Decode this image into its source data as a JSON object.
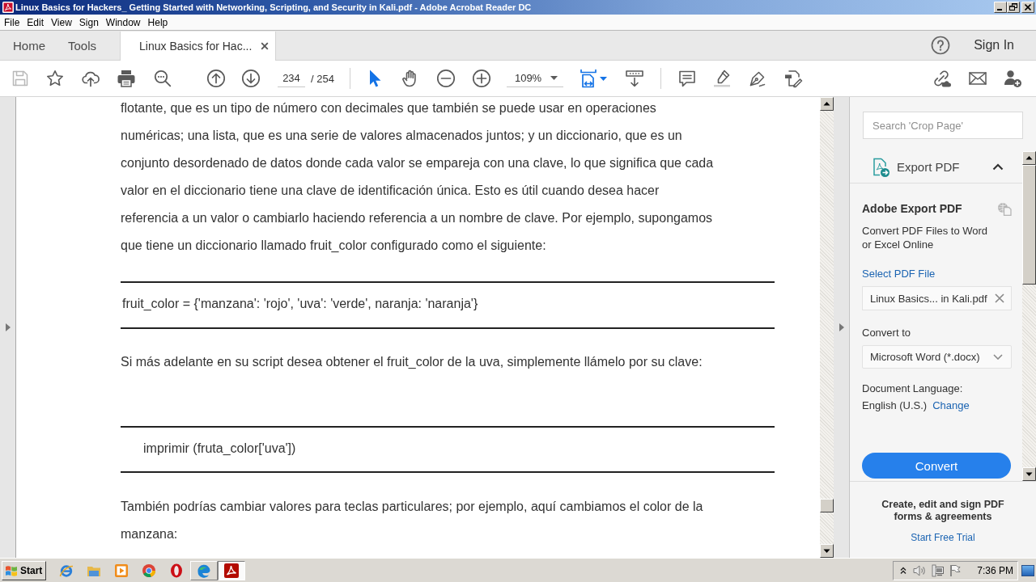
{
  "window": {
    "title": "Linux Basics for Hackers_ Getting Started with Networking, Scripting, and Security in Kali.pdf - Adobe Acrobat Reader DC"
  },
  "menu": [
    "File",
    "Edit",
    "View",
    "Sign",
    "Window",
    "Help"
  ],
  "tabs": [
    {
      "kind": "nav",
      "label": "Home",
      "selected": false
    },
    {
      "kind": "nav",
      "label": "Tools",
      "selected": false
    },
    {
      "kind": "document",
      "label": "Linux Basics for Hac...",
      "selected": true
    }
  ],
  "account": {
    "sign_in": "Sign In"
  },
  "toolbar": {
    "save": {
      "disabled": true
    },
    "page_current": "234",
    "page_total": "/ 254",
    "pointer_tools": [
      {
        "kind": "select",
        "selected": true
      },
      {
        "kind": "hand",
        "selected": false
      }
    ],
    "zoom": "109%"
  },
  "document": {
    "blocks": [
      {
        "kind": "paragraph",
        "text": "flotante, que es un tipo de número con decimales que también se puede usar en operaciones\nnuméricas; una lista, que es una serie de valores almacenados juntos; y un diccionario, que es un\nconjunto desordenado de datos donde cada valor se empareja con una clave, lo que significa que cada\nvalor en el diccionario tiene una clave de identificación única. Esto es útil cuando desea hacer\nreferencia a un valor o cambiarlo haciendo referencia a un nombre de clave. Por ejemplo, supongamos\nque tiene un diccionario llamado fruit_color configurado como el siguiente:"
      },
      {
        "kind": "code",
        "indented": false,
        "text": "fruit_color = {'manzana': 'rojo', 'uva': 'verde', naranja: 'naranja'}"
      },
      {
        "kind": "paragraph",
        "text": "Si más adelante en su script desea obtener el fruit_color de la uva, simplemente llámelo por su clave:"
      },
      {
        "kind": "code",
        "indented": true,
        "text": "imprimir (fruta_color['uva'])"
      },
      {
        "kind": "paragraph",
        "text": "También podrías cambiar valores para teclas particulares; por ejemplo, aquí cambiamos el color de la\nmanzana:"
      }
    ]
  },
  "side_panel": {
    "search": {
      "placeholder": "Search 'Crop Page'"
    },
    "tool": {
      "title": "Export PDF",
      "expanded": true,
      "heading": "Adobe Export PDF",
      "description": "Convert PDF Files to Word or Excel Online",
      "select_file": "Select PDF File",
      "file": "Linux Basics... in Kali.pdf",
      "convert_to_label": "Convert to",
      "format": "Microsoft Word (*.docx)",
      "language_label": "Document Language:",
      "language": "English (U.S.)",
      "change_link": "Change",
      "convert_button": "Convert"
    },
    "promo": {
      "text": "Create, edit and sign PDF forms & agreements",
      "link": "Start Free Trial"
    }
  },
  "taskbar": {
    "start": "Start",
    "apps": [
      {
        "kind": "e-browser",
        "running": false,
        "selected": false
      },
      {
        "kind": "folder",
        "running": false,
        "selected": false
      },
      {
        "kind": "player",
        "running": false,
        "selected": false
      },
      {
        "kind": "circle-browser",
        "running": false,
        "selected": false
      },
      {
        "kind": "ring-browser",
        "running": false,
        "selected": false
      },
      {
        "kind": "wave-browser",
        "running": true,
        "selected": false
      },
      {
        "kind": "pdf-reader",
        "running": true,
        "selected": true
      }
    ],
    "clock": "7:36 PM"
  }
}
